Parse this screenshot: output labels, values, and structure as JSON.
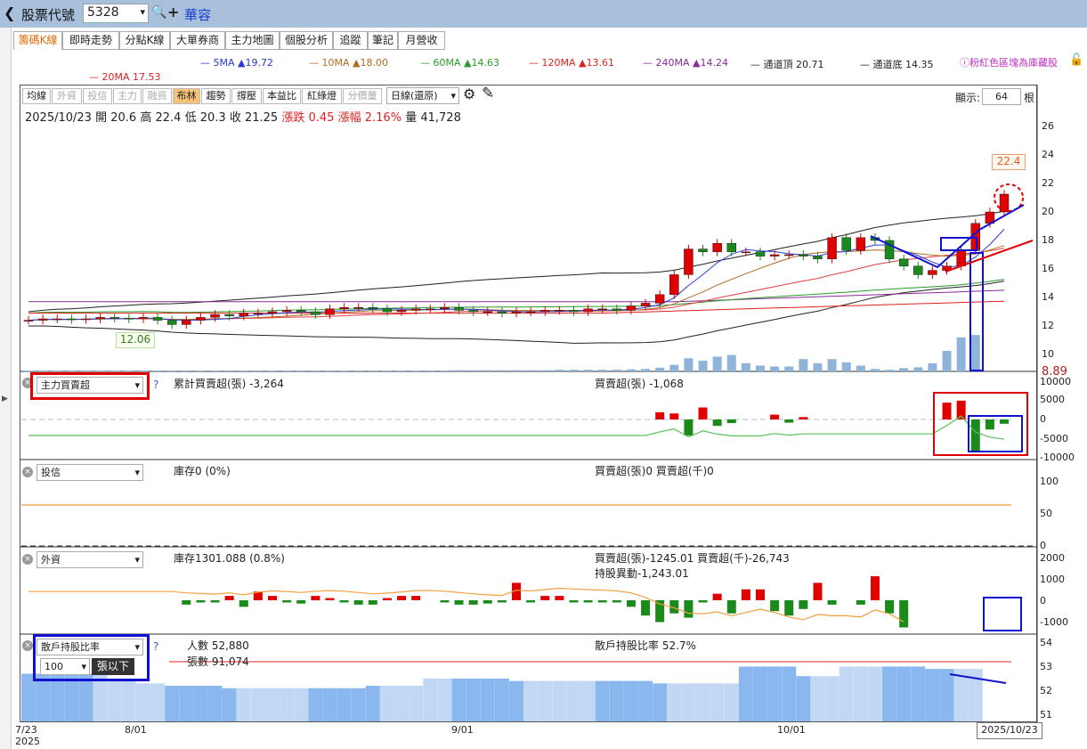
{
  "header": {
    "back_glyph": "❮",
    "label": "股票代號",
    "code": "5328",
    "name": "華容",
    "search_glyph": "🔍",
    "plus_glyph": "+",
    "dropdown_glyph": "▾"
  },
  "tabs": [
    "籌碼K線",
    "即時走勢",
    "分點K線",
    "大單券商",
    "主力地圖",
    "個股分析",
    "追蹤",
    "筆記",
    "月營收"
  ],
  "ma_legend": [
    {
      "label": "5MA ▲19.72",
      "color": "#2a3ad8"
    },
    {
      "label": "10MA ▲18.00",
      "color": "#b06a20"
    },
    {
      "label": "60MA ▲14.63",
      "color": "#2a9a2a"
    },
    {
      "label": "120MA ▲13.61",
      "color": "#e02020"
    },
    {
      "label": "240MA ▲14.24",
      "color": "#8a2a9a"
    },
    {
      "label": "通道頂 20.71",
      "color": "#222"
    },
    {
      "label": "通道底 14.35",
      "color": "#222"
    },
    {
      "label": "20MA 17.53",
      "color": "#e02020"
    }
  ],
  "notice": "ⓘ粉紅色區塊為庫藏股",
  "lock_glyph": "🔓",
  "toolbar": {
    "buttons": [
      "均線",
      "外資",
      "投信",
      "主力",
      "融資",
      "布林",
      "趨勢",
      "撐壓",
      "本益比",
      "紅綠燈",
      "分價量"
    ],
    "period": "日線(還原)",
    "display_label": "顯示:",
    "display_value": "64",
    "display_unit": "根"
  },
  "ohlc": {
    "date": "2025/10/23",
    "open_label": "開",
    "open": "20.6",
    "high_label": "高",
    "high": "22.4",
    "low_label": "低",
    "low": "20.3",
    "close_label": "收",
    "close": "21.25",
    "chg_label": "漲跌",
    "chg": "0.45",
    "pct_label": "漲幅",
    "pct": "2.16%",
    "vol_label": "量",
    "vol": "41,728"
  },
  "price_axis": [
    "26",
    "24",
    "22",
    "20",
    "18",
    "16",
    "14",
    "12",
    "10"
  ],
  "max_label": "22.4",
  "min_label": "12.06",
  "last_vol_label": "8.89",
  "panel1": {
    "selector": "主力買賣超",
    "help": "?",
    "cum_label": "累計買賣超(張) -3,264",
    "net_label": "買賣超(張) -1,068",
    "axis": [
      "10000",
      "5000",
      "0",
      "-5000",
      "-10000"
    ]
  },
  "panel2": {
    "selector": "投信",
    "inv_label": "庫存0 (0%)",
    "net_label": "買賣超(張)0 買賣超(千)0",
    "axis": [
      "100",
      "50",
      "0"
    ]
  },
  "panel3": {
    "selector": "外資",
    "inv_label": "庫存1301.088 (0.8%)",
    "net_label": "買賣超(張)-1245.01 買賣超(千)-26,743",
    "hold_label": "持股異動-1,243.01",
    "axis": [
      "2000",
      "1000",
      "0",
      "-1000"
    ]
  },
  "panel4": {
    "selector": "散戶持股比率",
    "help": "?",
    "people_label": "人數 52,880",
    "lots_label": "張數 91,074",
    "ratio_label": "散戶持股比率 52.7%",
    "lot_value": "100",
    "lot_btn": "張以下",
    "axis": [
      "54",
      "53",
      "52",
      "51"
    ]
  },
  "date_axis": [
    {
      "label": "7/23"
    },
    {
      "label": "8/01"
    },
    {
      "label": "9/01"
    },
    {
      "label": "10/01"
    }
  ],
  "year_label": "2025",
  "last_date": "2025/10/23",
  "chart_data": {
    "type": "candlestick",
    "dates": [
      "2025/7/23",
      "2025/10/23"
    ],
    "last_bar": {
      "open": 20.6,
      "high": 22.4,
      "low": 20.3,
      "close": 21.25,
      "volume": 41728
    },
    "ylim": [
      9,
      27
    ],
    "close_series": [
      12.4,
      12.5,
      12.5,
      12.45,
      12.5,
      12.6,
      12.55,
      12.5,
      12.6,
      12.4,
      12.1,
      12.4,
      12.6,
      12.8,
      12.7,
      12.9,
      12.9,
      13.0,
      13.1,
      13.0,
      12.8,
      13.2,
      13.3,
      13.3,
      13.2,
      13.0,
      13.1,
      13.2,
      13.2,
      13.3,
      13.1,
      13.0,
      13.0,
      12.9,
      13.0,
      13.0,
      13.1,
      13.1,
      13.0,
      13.2,
      13.2,
      13.1,
      13.4,
      13.6,
      14.2,
      15.6,
      17.4,
      17.2,
      17.8,
      17.2,
      17.2,
      16.9,
      17.0,
      17.0,
      16.9,
      16.7,
      18.2,
      17.3,
      18.2,
      18.0,
      16.7,
      16.2,
      15.6,
      15.9,
      16.2,
      17.3,
      19.2,
      20.0,
      21.25
    ],
    "volume_series": [
      0.2,
      0.2,
      0.2,
      0.2,
      0.2,
      0.2,
      0.2,
      0.2,
      0.2,
      0.2,
      0.2,
      0.2,
      0.2,
      0.2,
      0.2,
      0.2,
      0.2,
      0.2,
      0.2,
      0.2,
      0.2,
      0.2,
      0.2,
      0.2,
      0.2,
      0.2,
      0.2,
      0.2,
      0.2,
      0.2,
      0.3,
      0.3,
      0.3,
      0.3,
      0.3,
      0.3,
      0.3,
      0.4,
      0.4,
      0.4,
      0.4,
      0.4,
      0.5,
      0.6,
      0.9,
      1.6,
      3.2,
      2.6,
      3.6,
      4.0,
      2.0,
      1.4,
      1.2,
      1.2,
      3.0,
      2.0,
      3.0,
      2.2,
      1.4,
      0.6,
      0.4,
      0.8,
      1.0,
      2.0,
      5.0,
      8.3,
      8.89
    ],
    "main_net": [
      0,
      0,
      0,
      0,
      0,
      0,
      0,
      0,
      0,
      0,
      0,
      0,
      0,
      0,
      0,
      0,
      0,
      0,
      0,
      0,
      0,
      0,
      0,
      0,
      0,
      0,
      0,
      0,
      0,
      0,
      0,
      0,
      0,
      0,
      0,
      0,
      0,
      0,
      0,
      0,
      0,
      0,
      0,
      0,
      1800,
      1500,
      -4000,
      3000,
      -1600,
      -900,
      0,
      0,
      1200,
      -800,
      600,
      0,
      0,
      0,
      0,
      0,
      0,
      0,
      0,
      0,
      4200,
      4700,
      -8000,
      -2500,
      -1068
    ],
    "foreign_net": [
      0,
      0,
      0,
      0,
      0,
      0,
      0,
      0,
      0,
      0,
      0,
      -200,
      -100,
      -100,
      200,
      -300,
      400,
      200,
      -100,
      -150,
      200,
      100,
      -100,
      -200,
      -200,
      100,
      200,
      200,
      0,
      -100,
      -200,
      -200,
      -150,
      -100,
      800,
      -100,
      200,
      200,
      -100,
      -100,
      -100,
      -100,
      -300,
      -700,
      -1000,
      -600,
      -800,
      -100,
      300,
      -600,
      500,
      500,
      -500,
      -700,
      -400,
      800,
      -200,
      0,
      -200,
      1100,
      -600,
      -1245
    ],
    "retail_ratio": [
      52.5,
      52.5,
      52.5,
      52.5,
      52.5,
      52.5,
      52.3,
      52.3,
      52.1,
      52.1,
      52.0,
      52.0,
      52.0,
      52.0,
      51.9,
      51.9,
      51.9,
      51.9,
      51.9,
      51.9,
      51.9,
      51.9,
      51.9,
      51.9,
      52.0,
      52.0,
      52.0,
      52.0,
      52.3,
      52.3,
      52.3,
      52.3,
      52.3,
      52.3,
      52.2,
      52.2,
      52.2,
      52.2,
      52.2,
      52.2,
      52.2,
      52.2,
      52.2,
      52.2,
      52.1,
      52.1,
      52.1,
      52.1,
      52.1,
      52.1,
      52.8,
      52.8,
      52.8,
      52.8,
      52.4,
      52.4,
      52.4,
      52.8,
      52.8,
      52.8,
      52.8,
      52.8,
      52.8,
      52.7,
      52.7,
      52.7,
      52.7
    ]
  }
}
